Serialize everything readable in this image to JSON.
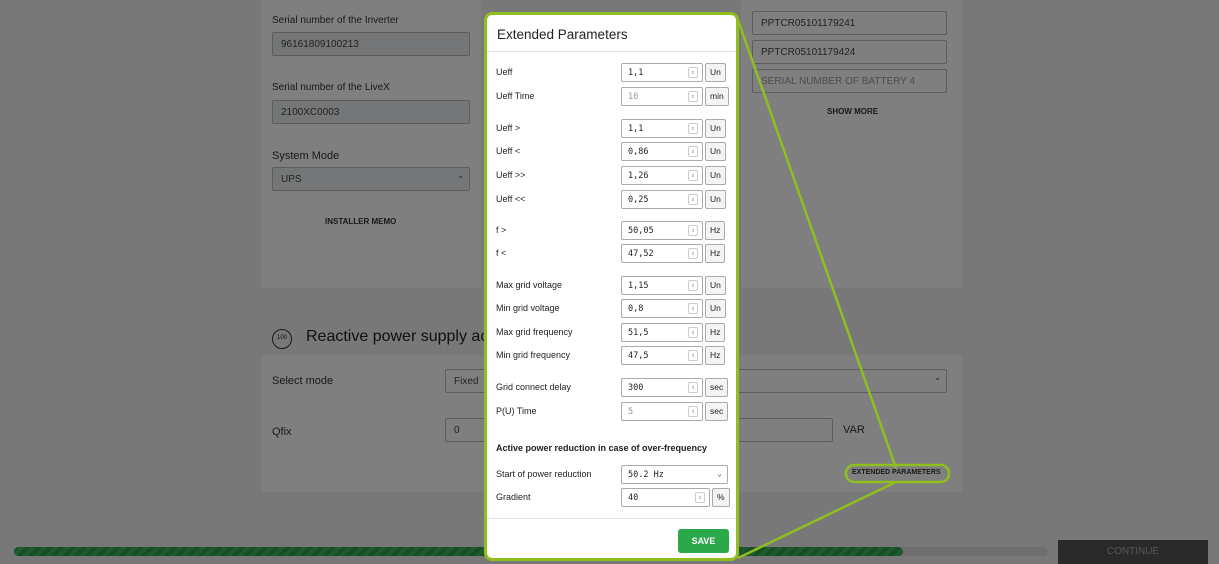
{
  "background": {
    "inverter_serial_label": "Serial number of the Inverter",
    "inverter_serial_value": "96161809100213",
    "livex_serial_label": "Serial number of the LiveX",
    "livex_serial_value": "2100XC0003",
    "system_mode_label": "System Mode",
    "system_mode_value": "UPS",
    "installer_memo": "INSTALLER MEMO",
    "battery_serials": [
      "PPTCR05101179241",
      "PPTCR05101179424"
    ],
    "battery4_placeholder": "SERIAL NUMBER OF BATTERY 4",
    "show_more": "SHOW MORE",
    "reactive_title": "Reactive power supply acc",
    "reactive_icon_text": "100",
    "select_mode_label": "Select mode",
    "select_mode_value": "Fixed",
    "qfix_label": "Qfix",
    "qfix_value": "0",
    "var_unit": "VAR",
    "extended_parameters": "EXTENDED PARAMETERS",
    "continue_label": "CONTINUE"
  },
  "modal": {
    "title": "Extended Parameters",
    "rows": [
      {
        "label": "Ueff",
        "value": "1,1",
        "unit": "Un",
        "disabled": false
      },
      {
        "label": "Ueff Time",
        "value": "10",
        "unit": "min",
        "disabled": true
      },
      {
        "label": "Ueff >",
        "value": "1,1",
        "unit": "Un",
        "disabled": false
      },
      {
        "label": "Ueff <",
        "value": "0,86",
        "unit": "Un",
        "disabled": false
      },
      {
        "label": "Ueff >>",
        "value": "1,26",
        "unit": "Un",
        "disabled": false
      },
      {
        "label": "Ueff <<",
        "value": "0,25",
        "unit": "Un",
        "disabled": false
      },
      {
        "label": "f >",
        "value": "50,05",
        "unit": "Hz",
        "disabled": false
      },
      {
        "label": "f <",
        "value": "47,52",
        "unit": "Hz",
        "disabled": false
      },
      {
        "label": "Max grid voltage",
        "value": "1,15",
        "unit": "Un",
        "disabled": false
      },
      {
        "label": "Min grid voltage",
        "value": "0,8",
        "unit": "Un",
        "disabled": false
      },
      {
        "label": "Max grid frequency",
        "value": "51,5",
        "unit": "Hz",
        "disabled": false
      },
      {
        "label": "Min grid frequency",
        "value": "47,5",
        "unit": "Hz",
        "disabled": false
      },
      {
        "label": "Grid connect delay",
        "value": "300",
        "unit": "sec",
        "disabled": false
      },
      {
        "label": "P(U) Time",
        "value": "5",
        "unit": "sec",
        "disabled": true
      }
    ],
    "apr_heading": "Active power reduction in case of over-frequency",
    "start_label": "Start of power reduction",
    "start_value": "50.2 Hz",
    "gradient_label": "Gradient",
    "gradient_value": "40",
    "gradient_unit": "%",
    "save_label": "SAVE"
  },
  "progress": {
    "fraction": 0.86
  },
  "colors": {
    "accent": "#8fbe1e",
    "save": "#2aa84a",
    "progress": "#2e9d4a"
  }
}
